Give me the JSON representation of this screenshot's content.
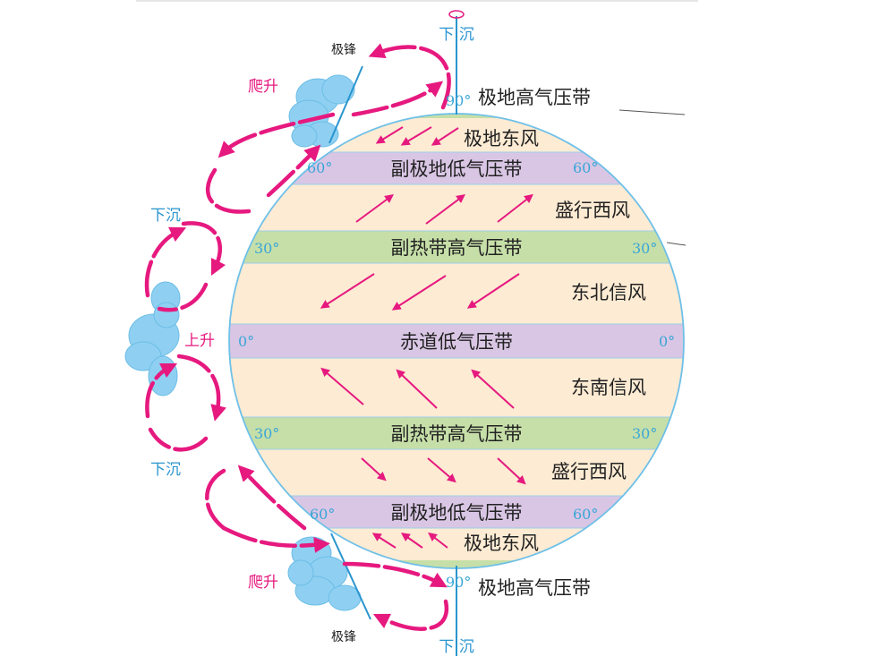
{
  "top_axis": {
    "sink": "下 沉"
  },
  "bottom_axis": {
    "sink": "下 沉"
  },
  "poles": {
    "north_deg": "90°",
    "south_deg": "90°"
  },
  "bands": {
    "north_polar_high": "极地高气压带",
    "north_polar_easterlies": "极地东风",
    "north_sub_polar_low": "副极地低气压带",
    "north_westerlies": "盛行西风",
    "north_subtropical_high": "副热带高气压带",
    "ne_trades": "东北信风",
    "equatorial_low": "赤道低气压带",
    "se_trades": "东南信风",
    "south_subtropical_high": "副热带高气压带",
    "south_westerlies": "盛行西风",
    "south_sub_polar_low": "副极地低气压带",
    "south_polar_easterlies": "极地东风",
    "south_polar_high": "极地高气压带"
  },
  "latitudes": {
    "n60_left": "60°",
    "n60_right": "60°",
    "n30_left": "30°",
    "n30_right": "30°",
    "eq_left": "0°",
    "eq_right": "0°",
    "s30_left": "30°",
    "s30_right": "30°",
    "s60_left": "60°",
    "s60_right": "60°"
  },
  "side_labels": {
    "north_front": "极锋",
    "north_climb": "爬升",
    "north_sink": "下沉",
    "equator_rise": "上升",
    "south_sink": "下沉",
    "south_climb": "爬升",
    "south_front": "极锋"
  },
  "colors": {
    "circulation_arrow": "#e6197f",
    "pressure_low_band": "#d9c6e4",
    "pressure_high_band": "#c6dfa8",
    "wind_zone": "#fdebd3",
    "latitude_text": "#3aa6d8",
    "axis": "#2a95cf",
    "cloud": "#8fd0f2"
  }
}
